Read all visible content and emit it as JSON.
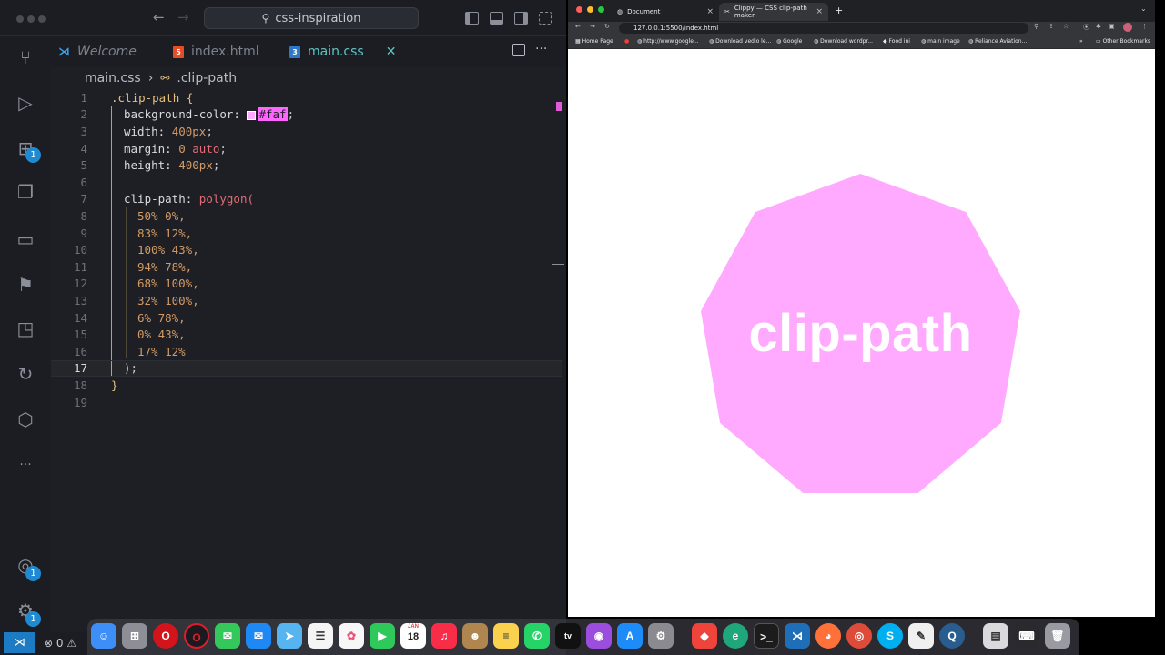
{
  "vscode": {
    "search_text": "css-inspiration",
    "tabs": [
      {
        "label": "Welcome"
      },
      {
        "label": "index.html"
      },
      {
        "label": "main.css",
        "close": "✕"
      }
    ],
    "breadcrumb": {
      "file": "main.css",
      "separator": "›",
      "symbol": ".clip-path"
    },
    "badges": {
      "extensions": "1",
      "accounts": "1",
      "settings": "1"
    },
    "status": {
      "errors": "0",
      "warnings_prefix": "⚠"
    },
    "line_numbers": [
      "1",
      "2",
      "3",
      "4",
      "5",
      "6",
      "7",
      "8",
      "9",
      "10",
      "11",
      "12",
      "13",
      "14",
      "15",
      "16",
      "17",
      "18",
      "19"
    ],
    "code": {
      "l1_selector": ".clip-path {",
      "l2_prop": "background-color: ",
      "l2_value": "#faf",
      "l2_end": ";",
      "l3_prop": "width: ",
      "l3_value": "400px",
      "l4_prop": "margin: ",
      "l4_value": "0",
      "l4_kw": "auto",
      "l5_prop": "height: ",
      "l5_value": "400px",
      "l7_prop": "clip-path: ",
      "l7_fn": "polygon(",
      "points": [
        "50% 0%,",
        "83% 12%,",
        "100% 43%,",
        "94% 78%,",
        "68% 100%,",
        "32% 100%,",
        "6% 78%,",
        "0% 43%,",
        "17% 12%"
      ],
      "l17": ");",
      "l18": "}"
    }
  },
  "browser": {
    "tabs": [
      {
        "title": "Document",
        "close": "×"
      },
      {
        "title": "Clippy — CSS clip-path maker",
        "close": "×"
      }
    ],
    "new_tab": "+",
    "url": "127.0.0.1:5500/index.html",
    "bookmarks": [
      "Home Page",
      "http://www.google...",
      "Download vedio le...",
      "Google",
      "Download wordpr...",
      "Food ini",
      "main image",
      "Reliance Aviation...",
      "Other Bookmarks"
    ],
    "page_text": "clip-path",
    "shape_color": "#faf"
  },
  "dock": {
    "apps": [
      "finder",
      "launchpad",
      "opera",
      "opera-gx",
      "messages",
      "mail",
      "maps",
      "reminders",
      "photos",
      "facetime",
      "calendar",
      "music",
      "contacts",
      "notes",
      "whatsapp",
      "apple-tv",
      "podcasts",
      "app-store",
      "system-settings",
      "anydesk",
      "edge-dev",
      "terminal",
      "vscode",
      "firefox",
      "chrome",
      "skype",
      "textedit",
      "quicktime",
      "preview",
      "keyboard",
      "trash"
    ],
    "calendar_month": "JAN",
    "calendar_day": "18"
  }
}
